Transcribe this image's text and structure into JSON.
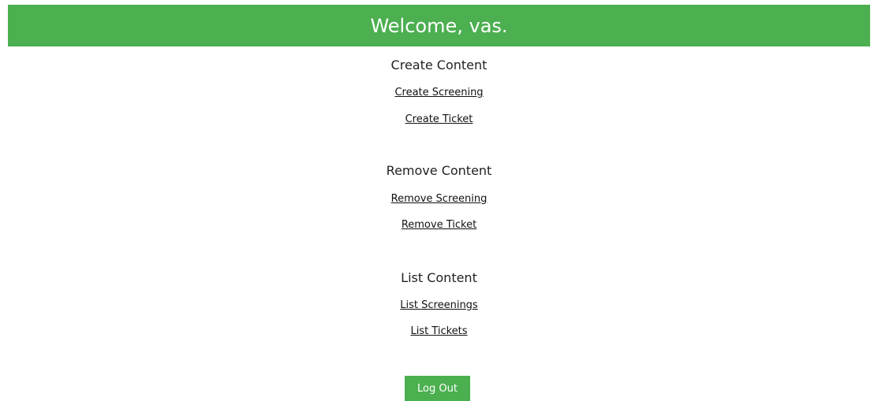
{
  "header": {
    "welcome": "Welcome, vas.",
    "color": "#4caf50"
  },
  "sections": [
    {
      "title": "Create Content",
      "links": [
        "Create Screening",
        "Create Ticket"
      ]
    },
    {
      "title": "Remove Content",
      "links": [
        "Remove Screening",
        "Remove Ticket"
      ]
    },
    {
      "title": "List Content",
      "links": [
        "List Screenings",
        "List Tickets"
      ]
    }
  ],
  "logout": {
    "label": "Log Out"
  }
}
